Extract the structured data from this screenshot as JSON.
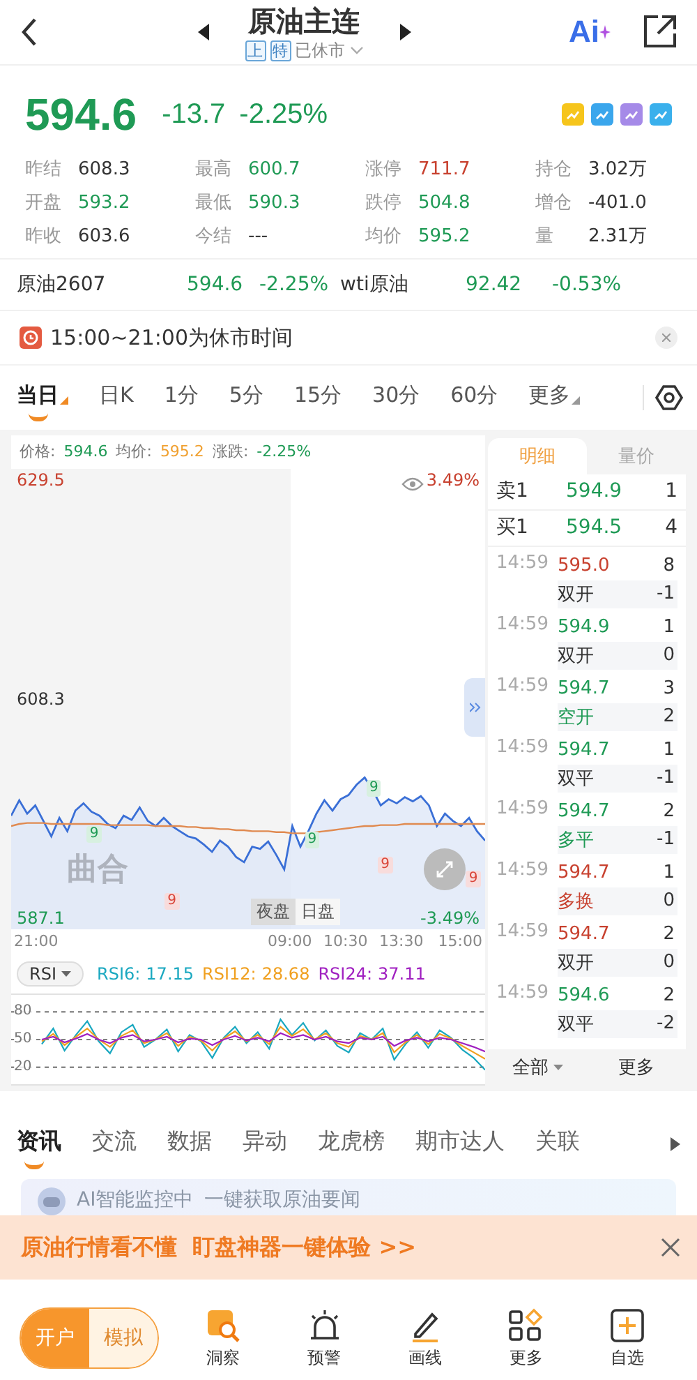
{
  "header": {
    "title": "原油主连",
    "badges": [
      "上",
      "特"
    ],
    "status": "已休市",
    "ai_label": "Ai"
  },
  "quote": {
    "price": "594.6",
    "change": "-13.7",
    "change_pct": "-2.25%",
    "color": "#1f9a55"
  },
  "stats": [
    {
      "label": "昨结",
      "value": "608.3",
      "color": "#333333"
    },
    {
      "label": "最高",
      "value": "600.7",
      "color": "#1f9a55"
    },
    {
      "label": "涨停",
      "value": "711.7",
      "color": "#c8412f"
    },
    {
      "label": "持仓",
      "value": "3.02万",
      "color": "#333333"
    },
    {
      "label": "开盘",
      "value": "593.2",
      "color": "#1f9a55"
    },
    {
      "label": "最低",
      "value": "590.3",
      "color": "#1f9a55"
    },
    {
      "label": "跌停",
      "value": "504.8",
      "color": "#1f9a55"
    },
    {
      "label": "增仓",
      "value": "-401.0",
      "color": "#333333"
    },
    {
      "label": "昨收",
      "value": "603.6",
      "color": "#333333"
    },
    {
      "label": "今结",
      "value": "---",
      "color": "#333333"
    },
    {
      "label": "均价",
      "value": "595.2",
      "color": "#1f9a55"
    },
    {
      "label": "量",
      "value": "2.31万",
      "color": "#333333"
    }
  ],
  "related": [
    {
      "name": "原油2607",
      "price": "594.6",
      "change": "-2.25%",
      "color": "#1f9a55"
    },
    {
      "name": "wti原油",
      "price": "92.42",
      "change": "-0.53%",
      "color": "#1f9a55"
    }
  ],
  "notice": {
    "text": "15:00~21:00为休市时间"
  },
  "periods": [
    {
      "label": "当日",
      "selected": true,
      "dropdown": true
    },
    {
      "label": "日K",
      "selected": false,
      "dropdown": false
    },
    {
      "label": "1分",
      "selected": false,
      "dropdown": false
    },
    {
      "label": "5分",
      "selected": false,
      "dropdown": false
    },
    {
      "label": "15分",
      "selected": false,
      "dropdown": false
    },
    {
      "label": "30分",
      "selected": false,
      "dropdown": false
    },
    {
      "label": "60分",
      "selected": false,
      "dropdown": false
    },
    {
      "label": "更多",
      "selected": false,
      "dropdown": true
    }
  ],
  "chart": {
    "legend": [
      {
        "value": "594.6",
        "color": "#1f9a55"
      },
      {
        "value": "595.2",
        "color": "#f0a030"
      }
    ],
    "change": {
      "label": "涨跌:",
      "value": "-2.25%",
      "color": "#1f9a55"
    },
    "times": [
      "21:00",
      "09:00",
      "10:30",
      "13:30",
      "15:00"
    ],
    "high_pct": "3.49%",
    "low_pct": "-3.49%",
    "logo_text": "曲合",
    "sessions": [
      {
        "label": "夜盘",
        "selected": true
      },
      {
        "label": "日盘",
        "selected": false
      }
    ],
    "markers": [
      {
        "text": "9",
        "color": "#1f9a55"
      },
      {
        "text": "9",
        "color": "#d9463a"
      },
      {
        "text": "9",
        "color": "#1f9a55"
      },
      {
        "text": "9",
        "color": "#1f9a55"
      },
      {
        "text": "9",
        "color": "#d9463a"
      },
      {
        "text": "9",
        "color": "#d9463a"
      }
    ],
    "chart_data": {
      "type": "line",
      "ylim": [
        586.0,
        630.6
      ],
      "yticks": [
        {
          "value": 629.5,
          "label": "629.5"
        },
        {
          "value": 608.3,
          "label": "608.3"
        },
        {
          "value": 587.1,
          "label": "587.1"
        }
      ],
      "series": [
        {
          "name": "价格:",
          "color": "#3a6fd6",
          "values": [
            597.0,
            598.5,
            597.2,
            598.0,
            596.5,
            595.0,
            596.8,
            595.5,
            597.5,
            598.2,
            597.4,
            597.0,
            596.2,
            595.8,
            597.0,
            596.6,
            597.8,
            596.5,
            596.0,
            596.8,
            596.0,
            595.5,
            595.0,
            594.8,
            594.2,
            593.5,
            594.6,
            594.0,
            593.0,
            592.5,
            594.0,
            593.8,
            594.5,
            593.2,
            591.8,
            596.0,
            594.0,
            595.5,
            597.2,
            598.5,
            597.5,
            598.6,
            599.0,
            600.0,
            600.7,
            599.5,
            598.0,
            598.6,
            598.2,
            598.8,
            598.4,
            598.9,
            598.0,
            596.0,
            597.2,
            596.5,
            596.0,
            596.8,
            595.5,
            594.6
          ]
        },
        {
          "name": "均价:",
          "color": "#e08a50",
          "values": [
            596.0,
            596.2,
            596.3,
            596.3,
            596.3,
            596.2,
            596.2,
            596.2,
            596.2,
            596.2,
            596.2,
            596.2,
            596.1,
            596.1,
            596.1,
            596.1,
            596.1,
            596.1,
            596.0,
            596.0,
            596.0,
            596.0,
            595.9,
            595.9,
            595.8,
            595.8,
            595.7,
            595.7,
            595.6,
            595.6,
            595.5,
            595.5,
            595.5,
            595.4,
            595.4,
            595.3,
            595.3,
            595.3,
            595.4,
            595.5,
            595.6,
            595.7,
            595.8,
            595.9,
            596.0,
            596.0,
            596.1,
            596.1,
            596.1,
            596.2,
            596.2,
            596.2,
            596.2,
            596.2,
            596.2,
            596.2,
            596.2,
            596.2,
            596.2,
            596.2
          ]
        }
      ]
    }
  },
  "rsi": {
    "selector": "RSI",
    "legend": [
      "17.15",
      "28.68",
      "37.11"
    ],
    "chart_data": {
      "type": "line",
      "ylim": [
        0,
        100
      ],
      "yticks": [
        80,
        50,
        20
      ],
      "grid": true,
      "series": [
        {
          "name": "RSI6:",
          "color": "#1aa8c0",
          "values": [
            45,
            62,
            38,
            55,
            70,
            48,
            35,
            58,
            66,
            42,
            50,
            61,
            37,
            55,
            48,
            30,
            52,
            64,
            46,
            58,
            40,
            72,
            55,
            68,
            49,
            60,
            43,
            36,
            57,
            50,
            62,
            28,
            45,
            58,
            41,
            60,
            52,
            39,
            30,
            17
          ]
        },
        {
          "name": "RSI12:",
          "color": "#f0a020",
          "values": [
            48,
            56,
            44,
            53,
            62,
            50,
            42,
            54,
            60,
            46,
            50,
            57,
            43,
            53,
            49,
            38,
            51,
            59,
            48,
            55,
            45,
            64,
            54,
            61,
            50,
            57,
            46,
            42,
            54,
            50,
            57,
            36,
            47,
            55,
            45,
            56,
            51,
            43,
            36,
            29
          ]
        },
        {
          "name": "RSI24:",
          "color": "#a020c0",
          "values": [
            50,
            53,
            47,
            51,
            56,
            50,
            46,
            52,
            55,
            48,
            50,
            53,
            47,
            51,
            50,
            44,
            50,
            54,
            49,
            52,
            48,
            57,
            52,
            55,
            50,
            53,
            48,
            46,
            52,
            50,
            53,
            43,
            49,
            52,
            48,
            52,
            50,
            46,
            42,
            37
          ]
        }
      ]
    }
  },
  "detail": {
    "tabs": [
      {
        "label": "明细",
        "selected": true
      },
      {
        "label": "量价",
        "selected": false
      }
    ],
    "book": [
      {
        "side": "卖1",
        "price": "594.9",
        "qty": "1",
        "color": "#1f9a55"
      },
      {
        "side": "买1",
        "price": "594.5",
        "qty": "4",
        "color": "#1f9a55"
      }
    ],
    "trades": [
      {
        "time": "14:59",
        "price": {
          "text": "595.0",
          "color": "#c8412f"
        },
        "qty": "8",
        "type": {
          "text": "双开",
          "color": "#333333"
        },
        "diff": "-1"
      },
      {
        "time": "14:59",
        "price": {
          "text": "594.9",
          "color": "#1f9a55"
        },
        "qty": "1",
        "type": {
          "text": "双开",
          "color": "#333333"
        },
        "diff": "0"
      },
      {
        "time": "14:59",
        "price": {
          "text": "594.7",
          "color": "#1f9a55"
        },
        "qty": "3",
        "type": {
          "text": "空开",
          "color": "#1f9a55"
        },
        "diff": "2"
      },
      {
        "time": "14:59",
        "price": {
          "text": "594.7",
          "color": "#1f9a55"
        },
        "qty": "1",
        "type": {
          "text": "双平",
          "color": "#333333"
        },
        "diff": "-1"
      },
      {
        "time": "14:59",
        "price": {
          "text": "594.7",
          "color": "#1f9a55"
        },
        "qty": "2",
        "type": {
          "text": "多平",
          "color": "#1f9a55"
        },
        "diff": "-1"
      },
      {
        "time": "14:59",
        "price": {
          "text": "594.7",
          "color": "#c8412f"
        },
        "qty": "1",
        "type": {
          "text": "多换",
          "color": "#c8412f"
        },
        "diff": "0"
      },
      {
        "time": "14:59",
        "price": {
          "text": "594.7",
          "color": "#c8412f"
        },
        "qty": "2",
        "type": {
          "text": "双开",
          "color": "#333333"
        },
        "diff": "0"
      },
      {
        "time": "14:59",
        "price": {
          "text": "594.6",
          "color": "#1f9a55"
        },
        "qty": "2",
        "type": {
          "text": "双平",
          "color": "#333333"
        },
        "diff": "-2"
      }
    ],
    "footer": [
      {
        "label": "全部",
        "dropdown": true
      },
      {
        "label": "更多",
        "dropdown": false
      }
    ]
  },
  "news_tabs": [
    {
      "label": "资讯",
      "selected": true
    },
    {
      "label": "交流",
      "selected": false
    },
    {
      "label": "数据",
      "selected": false
    },
    {
      "label": "异动",
      "selected": false
    },
    {
      "label": "龙虎榜",
      "selected": false
    },
    {
      "label": "期市达人",
      "selected": false
    },
    {
      "label": "关联",
      "selected": false
    }
  ],
  "ai_card": {
    "title": "AI智能监控中",
    "subtitle": "一键获取原油要闻"
  },
  "banner": {
    "text": "原油行情看不懂  盯盘神器一键体验 >>"
  },
  "bottom": {
    "modes": [
      {
        "label": "开户",
        "selected": true
      },
      {
        "label": "模拟",
        "selected": false
      }
    ],
    "items": [
      {
        "label": "洞察"
      },
      {
        "label": "预警"
      },
      {
        "label": "画线"
      },
      {
        "label": "更多"
      },
      {
        "label": "自选"
      }
    ]
  }
}
